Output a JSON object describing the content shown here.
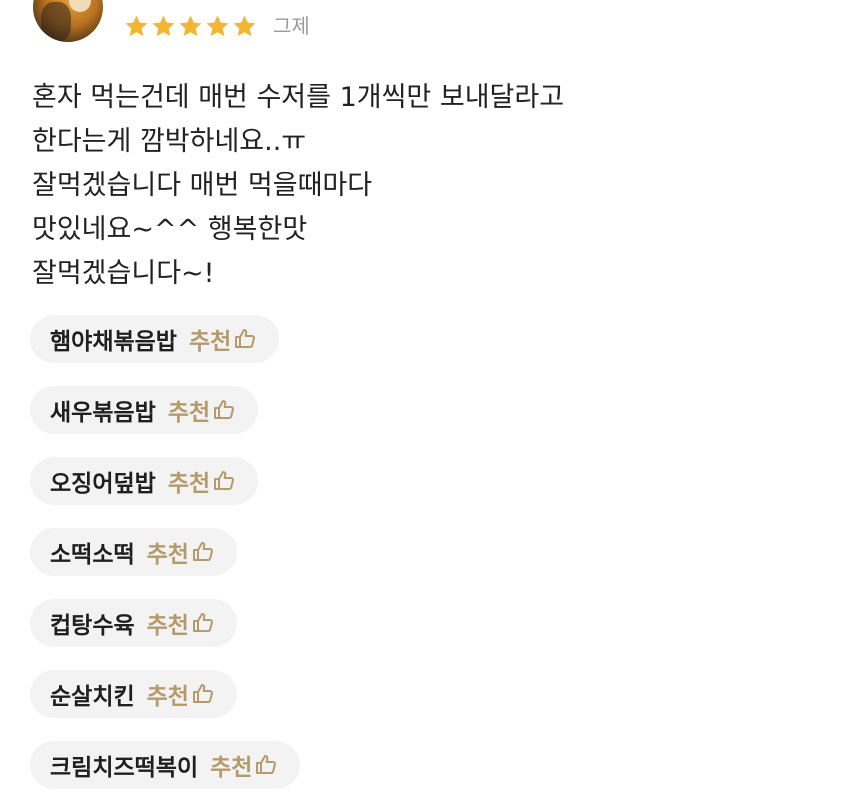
{
  "rating": {
    "stars": 5,
    "max_stars": 5,
    "star_color": "#f2b632",
    "star_icon": "star-icon"
  },
  "date": "그제",
  "review": {
    "lines": [
      "혼자 먹는건데 매번 수저를 1개씩만 보내달라고",
      "한다는게 깜박하네요..ㅠ",
      "잘먹겠습니다 매번 먹을때마다",
      "맛있네요~^^ 행복한맛",
      "잘먹겠습니다~!"
    ]
  },
  "menus": [
    {
      "name": "햄야채볶음밥",
      "recommend": "추천"
    },
    {
      "name": "새우볶음밥",
      "recommend": "추천"
    },
    {
      "name": "오징어덮밥",
      "recommend": "추천"
    },
    {
      "name": "소떡소떡",
      "recommend": "추천"
    },
    {
      "name": "컵탕수육",
      "recommend": "추천"
    },
    {
      "name": "순살치킨",
      "recommend": "추천"
    },
    {
      "name": "크림치즈떡복이",
      "recommend": "추천"
    }
  ],
  "colors": {
    "recommend": "#b59b6b",
    "chip_background": "#f3f3f3",
    "date": "#9a9a9a"
  },
  "icons": {
    "recommend": "thumbs-up-icon"
  }
}
